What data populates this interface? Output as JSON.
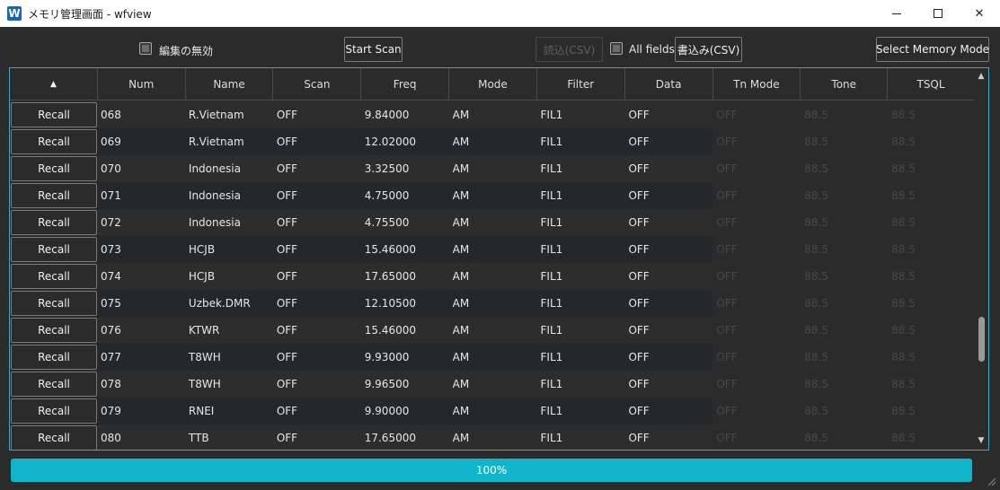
{
  "window": {
    "title": "メモリ管理画面 - wfview",
    "logo_letter": "W",
    "controls": {
      "minimize": "minimize-icon",
      "maximize": "maximize-icon",
      "close": "close-icon"
    }
  },
  "toolbar": {
    "disable_edit_label": "編集の無効",
    "start_scan_label": "Start Scan",
    "read_csv_label": "読込(CSV)",
    "all_fields_label": "All fields",
    "write_csv_label": "書込み(CSV)",
    "select_memory_mode_label": "Select Memory Mode"
  },
  "table": {
    "sort_indicator": "▲",
    "columns": [
      "Num",
      "Name",
      "Scan",
      "Freq",
      "Mode",
      "Filter",
      "Data",
      "Tn Mode",
      "Tone",
      "TSQL"
    ],
    "recall_label": "Recall",
    "rows": [
      [
        "068",
        "R.Vietnam",
        "OFF",
        "9.84000",
        "AM",
        "FIL1",
        "OFF",
        "OFF",
        "88.5",
        "88.5"
      ],
      [
        "069",
        "R.Vietnam",
        "OFF",
        "12.02000",
        "AM",
        "FIL1",
        "OFF",
        "OFF",
        "88.5",
        "88.5"
      ],
      [
        "070",
        "Indonesia",
        "OFF",
        "3.32500",
        "AM",
        "FIL1",
        "OFF",
        "OFF",
        "88.5",
        "88.5"
      ],
      [
        "071",
        "Indonesia",
        "OFF",
        "4.75000",
        "AM",
        "FIL1",
        "OFF",
        "OFF",
        "88.5",
        "88.5"
      ],
      [
        "072",
        "Indonesia",
        "OFF",
        "4.75500",
        "AM",
        "FIL1",
        "OFF",
        "OFF",
        "88.5",
        "88.5"
      ],
      [
        "073",
        "HCJB",
        "OFF",
        "15.46000",
        "AM",
        "FIL1",
        "OFF",
        "OFF",
        "88.5",
        "88.5"
      ],
      [
        "074",
        "HCJB",
        "OFF",
        "17.65000",
        "AM",
        "FIL1",
        "OFF",
        "OFF",
        "88.5",
        "88.5"
      ],
      [
        "075",
        "Uzbek.DMR",
        "OFF",
        "12.10500",
        "AM",
        "FIL1",
        "OFF",
        "OFF",
        "88.5",
        "88.5"
      ],
      [
        "076",
        "KTWR",
        "OFF",
        "15.46000",
        "AM",
        "FIL1",
        "OFF",
        "OFF",
        "88.5",
        "88.5"
      ],
      [
        "077",
        "T8WH",
        "OFF",
        "9.93000",
        "AM",
        "FIL1",
        "OFF",
        "OFF",
        "88.5",
        "88.5"
      ],
      [
        "078",
        "T8WH",
        "OFF",
        "9.96500",
        "AM",
        "FIL1",
        "OFF",
        "OFF",
        "88.5",
        "88.5"
      ],
      [
        "079",
        "RNEI",
        "OFF",
        "9.90000",
        "AM",
        "FIL1",
        "OFF",
        "OFF",
        "88.5",
        "88.5"
      ],
      [
        "080",
        "TTB",
        "OFF",
        "17.65000",
        "AM",
        "FIL1",
        "OFF",
        "OFF",
        "88.5",
        "88.5"
      ]
    ],
    "scroll_position_fraction": 0.78
  },
  "progress": {
    "value_fraction": 1.0,
    "label": "100%",
    "color": "#11b5c9"
  },
  "colors": {
    "accent_border": "#3aa7c7",
    "background": "#2b2b2b"
  }
}
